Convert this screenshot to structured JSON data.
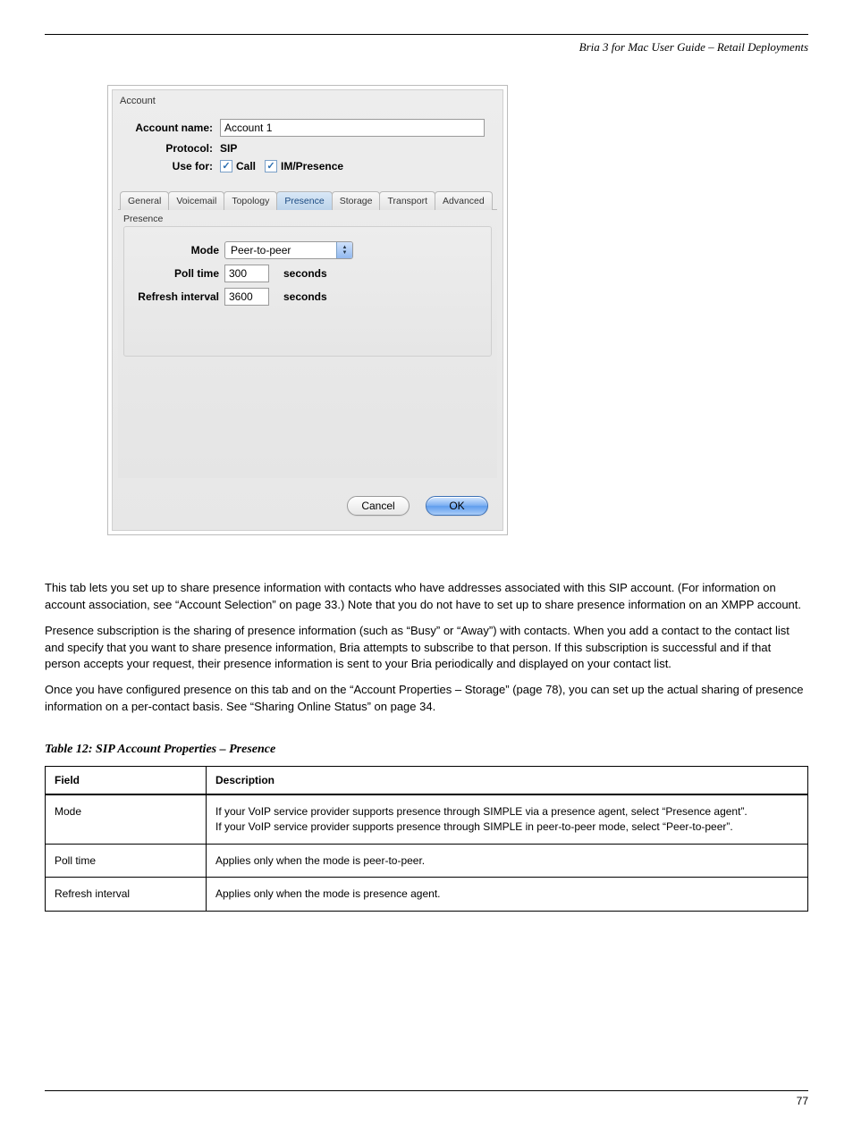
{
  "header": {
    "right": "Bria 3 for Mac User Guide – Retail Deployments"
  },
  "dialog": {
    "section_label": "Account",
    "account_name_label": "Account name:",
    "account_name_value": "Account 1",
    "protocol_label": "Protocol:",
    "protocol_value": "SIP",
    "use_for_label": "Use for:",
    "cb_call_label": "Call",
    "cb_im_label": "IM/Presence",
    "tabs": {
      "general": "General",
      "voicemail": "Voicemail",
      "topology": "Topology",
      "presence": "Presence",
      "storage": "Storage",
      "transport": "Transport",
      "advanced": "Advanced"
    },
    "presence": {
      "group_label": "Presence",
      "mode_label": "Mode",
      "mode_value": "Peer-to-peer",
      "poll_label": "Poll time",
      "poll_value": "300",
      "poll_unit": "seconds",
      "refresh_label": "Refresh interval",
      "refresh_value": "3600",
      "refresh_unit": "seconds"
    },
    "buttons": {
      "cancel": "Cancel",
      "ok": "OK"
    }
  },
  "body": {
    "p1": "This tab lets you set up to share presence information with contacts who have addresses associated with this SIP account. (For information on account association, see “Account Selection” on page 33.) Note that you do not have to set up to share presence information on an XMPP account.",
    "p2": "Presence subscription is the sharing of presence information (such as “Busy” or “Away”) with contacts. When you add a contact to the contact list and specify that you want to share presence information, Bria attempts to subscribe to that person. If this subscription is successful and if that person accepts your request, their presence information is sent to your Bria periodically and displayed on your contact list.",
    "p3": "Once you have configured presence on this tab and on the “Account Properties – Storage” (page 78), you can set up the actual sharing of presence information on a per-contact basis. See “Sharing Online Status” on page 34."
  },
  "table": {
    "title": "Table 12: SIP Account Properties – Presence",
    "hField": "Field",
    "hDesc": "Description",
    "rows": [
      {
        "field": "Mode",
        "desc": "If your VoIP service provider supports presence through SIMPLE via a presence agent, select “Presence agent”.\nIf your VoIP service provider supports presence through SIMPLE in peer-to-peer mode, select “Peer-to-peer”."
      },
      {
        "field": "Poll time",
        "desc": "Applies only when the mode is peer-to-peer."
      },
      {
        "field": "Refresh interval",
        "desc": "Applies only when the mode is presence agent."
      }
    ]
  },
  "footer": {
    "page": "77"
  }
}
